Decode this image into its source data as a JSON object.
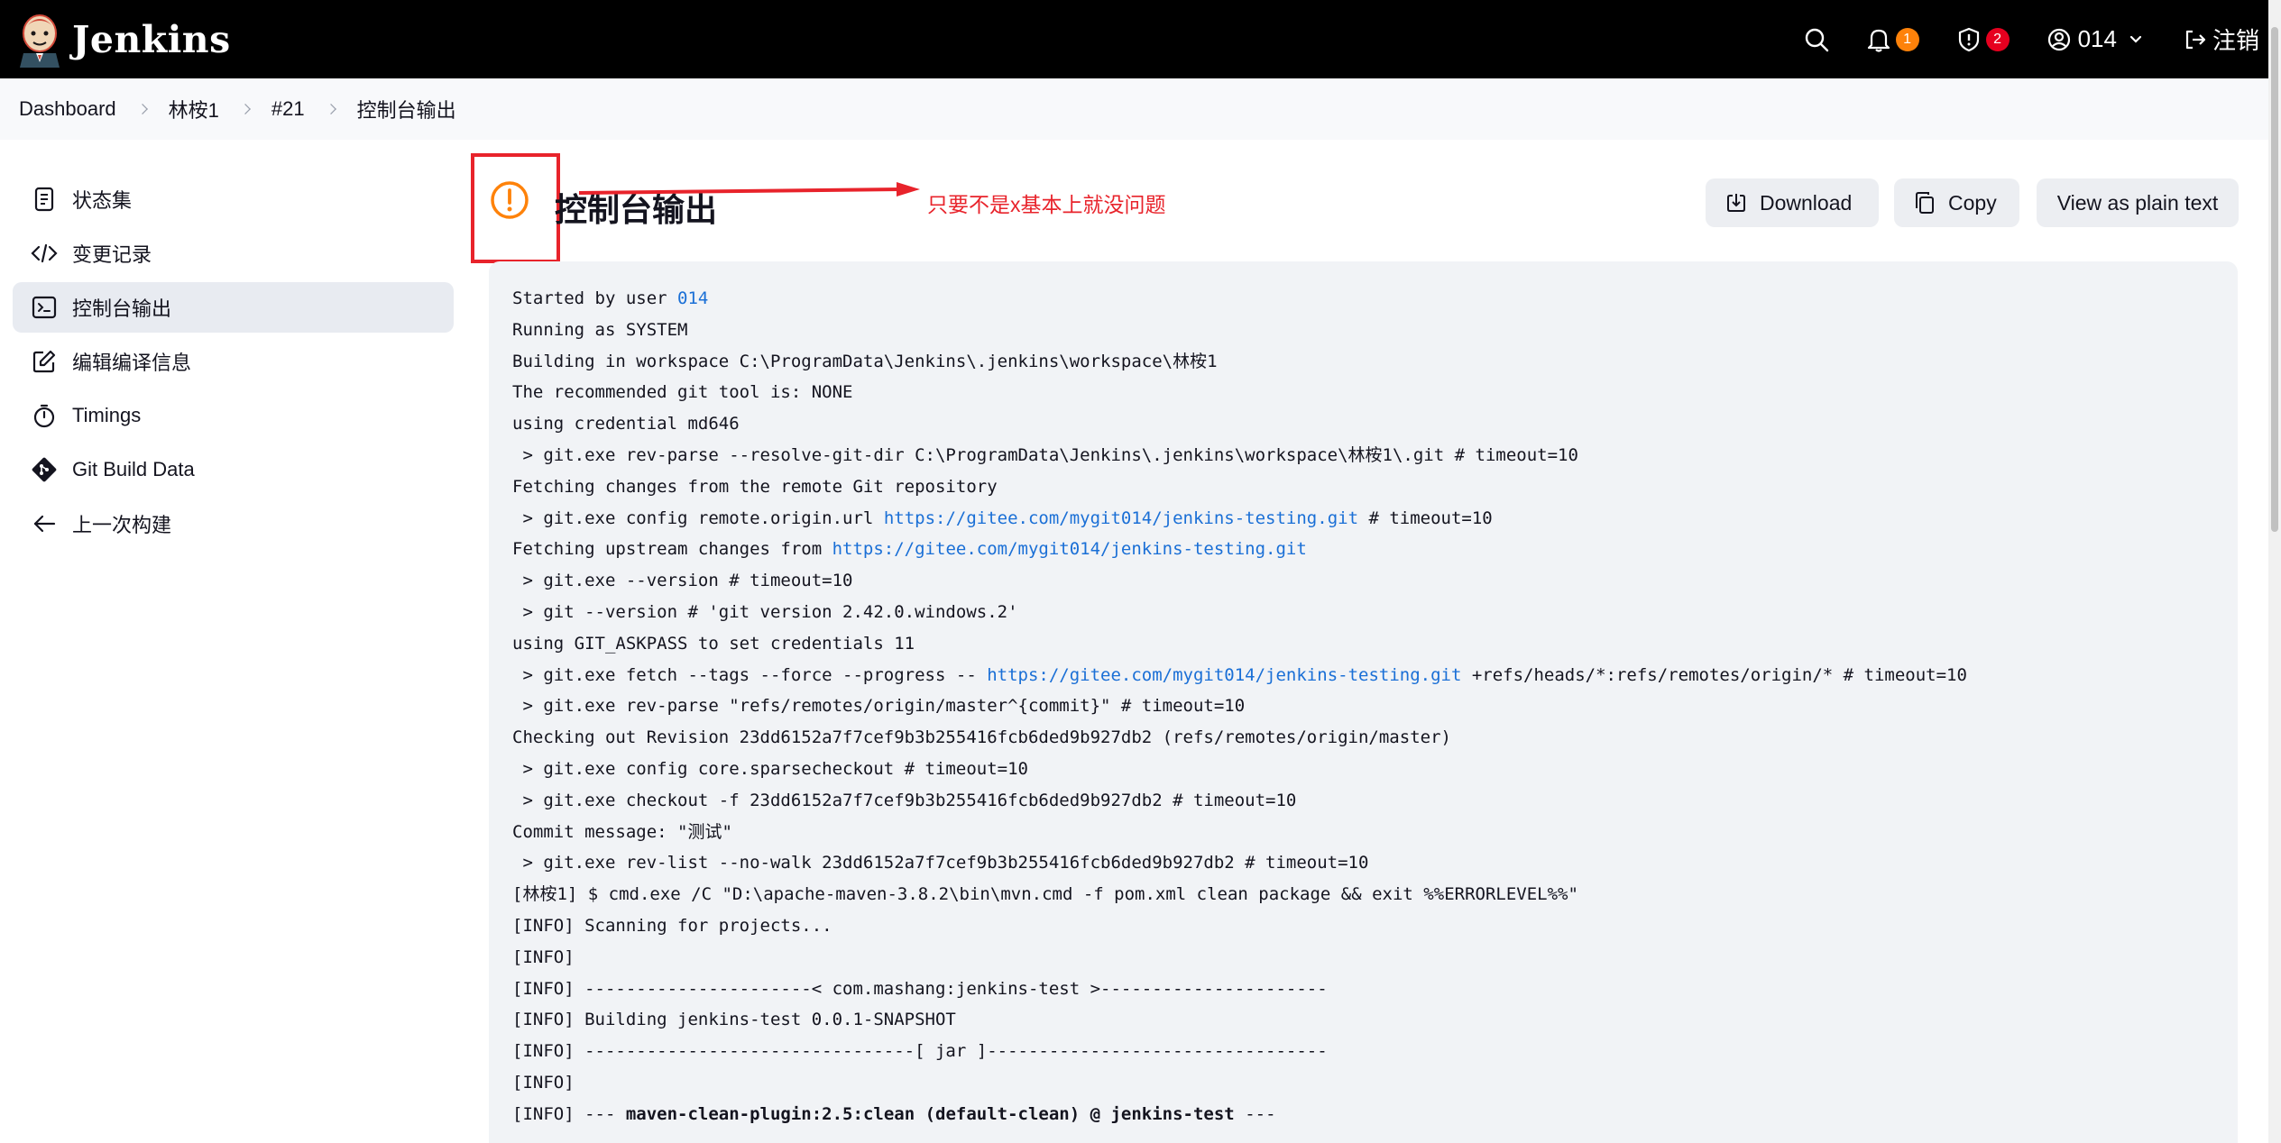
{
  "header": {
    "app_name": "Jenkins",
    "notifications_count": "1",
    "security_count": "2",
    "user_name": "014",
    "logout_label": "注销",
    "colors": {
      "bar": "#000000",
      "notif_badge": "#fe820a",
      "security_badge": "#e6001f"
    }
  },
  "breadcrumb": [
    "Dashboard",
    "林桉1",
    "#21",
    "控制台输出"
  ],
  "sidebar": {
    "items": [
      {
        "label": "状态集",
        "icon": "document-icon",
        "active": false
      },
      {
        "label": "变更记录",
        "icon": "code-icon",
        "active": false
      },
      {
        "label": "控制台输出",
        "icon": "terminal-icon",
        "active": true
      },
      {
        "label": "编辑编译信息",
        "icon": "edit-icon",
        "active": false
      },
      {
        "label": "Timings",
        "icon": "stopwatch-icon",
        "active": false
      },
      {
        "label": "Git Build Data",
        "icon": "git-icon",
        "active": false
      },
      {
        "label": "上一次构建",
        "icon": "arrow-left-icon",
        "active": false
      }
    ]
  },
  "main": {
    "title": "控制台输出",
    "status_icon": "warning-circle-icon",
    "annotation": "只要不是x基本上就没问题",
    "buttons": {
      "download": "Download",
      "copy": "Copy",
      "plain_text": "View as plain text"
    },
    "colors": {
      "annotation": "#e8232b",
      "warning": "#fe820a",
      "link": "#1a6fd6"
    }
  },
  "console": {
    "lines": [
      [
        {
          "t": "Started by user "
        },
        {
          "t": "014",
          "link": true
        }
      ],
      [
        {
          "t": "Running as SYSTEM"
        }
      ],
      [
        {
          "t": "Building in workspace C:\\ProgramData\\Jenkins\\.jenkins\\workspace\\林桉1"
        }
      ],
      [
        {
          "t": "The recommended git tool is: NONE"
        }
      ],
      [
        {
          "t": "using credential md646"
        }
      ],
      [
        {
          "t": " > git.exe rev-parse --resolve-git-dir C:\\ProgramData\\Jenkins\\.jenkins\\workspace\\林桉1\\.git # timeout=10"
        }
      ],
      [
        {
          "t": "Fetching changes from the remote Git repository"
        }
      ],
      [
        {
          "t": " > git.exe config remote.origin.url "
        },
        {
          "t": "https://gitee.com/mygit014/jenkins-testing.git",
          "link": true
        },
        {
          "t": " # timeout=10"
        }
      ],
      [
        {
          "t": "Fetching upstream changes from "
        },
        {
          "t": "https://gitee.com/mygit014/jenkins-testing.git",
          "link": true
        }
      ],
      [
        {
          "t": " > git.exe --version # timeout=10"
        }
      ],
      [
        {
          "t": " > git --version # 'git version 2.42.0.windows.2'"
        }
      ],
      [
        {
          "t": "using GIT_ASKPASS to set credentials 11"
        }
      ],
      [
        {
          "t": " > git.exe fetch --tags --force --progress -- "
        },
        {
          "t": "https://gitee.com/mygit014/jenkins-testing.git",
          "link": true
        },
        {
          "t": " +refs/heads/*:refs/remotes/origin/* # timeout=10"
        }
      ],
      [
        {
          "t": " > git.exe rev-parse \"refs/remotes/origin/master^{commit}\" # timeout=10"
        }
      ],
      [
        {
          "t": "Checking out Revision 23dd6152a7f7cef9b3b255416fcb6ded9b927db2 (refs/remotes/origin/master)"
        }
      ],
      [
        {
          "t": " > git.exe config core.sparsecheckout # timeout=10"
        }
      ],
      [
        {
          "t": " > git.exe checkout -f 23dd6152a7f7cef9b3b255416fcb6ded9b927db2 # timeout=10"
        }
      ],
      [
        {
          "t": "Commit message: \"测试\""
        }
      ],
      [
        {
          "t": " > git.exe rev-list --no-walk 23dd6152a7f7cef9b3b255416fcb6ded9b927db2 # timeout=10"
        }
      ],
      [
        {
          "t": "[林桉1] $ cmd.exe /C \"D:\\apache-maven-3.8.2\\bin\\mvn.cmd -f pom.xml clean package && exit %%ERRORLEVEL%%\""
        }
      ],
      [
        {
          "t": "[INFO] Scanning for projects..."
        }
      ],
      [
        {
          "t": "[INFO]"
        }
      ],
      [
        {
          "t": "[INFO] ----------------------< com.mashang:jenkins-test >----------------------"
        }
      ],
      [
        {
          "t": "[INFO] Building jenkins-test 0.0.1-SNAPSHOT"
        }
      ],
      [
        {
          "t": "[INFO] --------------------------------[ jar ]---------------------------------"
        }
      ],
      [
        {
          "t": "[INFO]"
        }
      ],
      [
        {
          "t": "[INFO] --- "
        },
        {
          "t": "maven-clean-plugin:2.5:clean (default-clean) @ jenkins-test",
          "bold": true
        },
        {
          "t": " ---"
        }
      ]
    ]
  }
}
